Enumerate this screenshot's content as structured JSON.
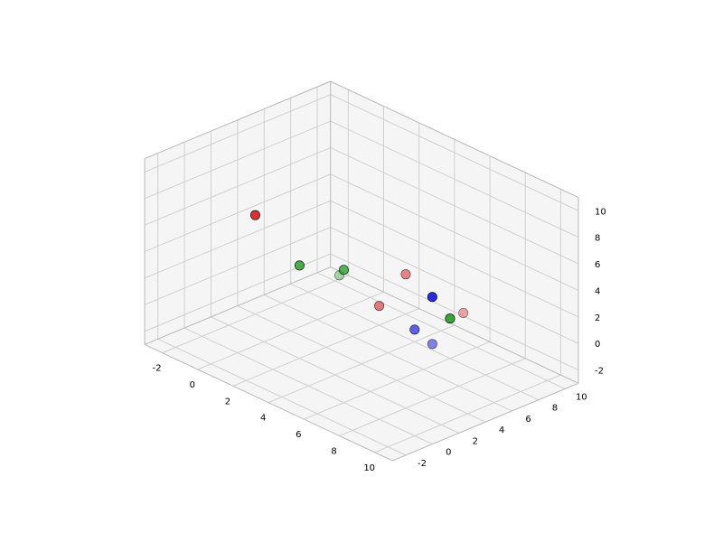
{
  "chart_data": {
    "type": "scatter3d",
    "title": "",
    "xlabel": "",
    "ylabel": "",
    "zlabel": "",
    "xlim": [
      -3,
      11
    ],
    "ylim": [
      -3,
      11
    ],
    "zlim": [
      -3,
      11
    ],
    "xticks": [
      -2,
      0,
      2,
      4,
      6,
      8,
      10
    ],
    "yticks": [
      -2,
      0,
      2,
      4,
      6,
      8,
      10
    ],
    "zticks": [
      -2,
      0,
      2,
      4,
      6,
      8,
      10
    ],
    "series": [
      {
        "name": "red",
        "color": "#d62728",
        "points": [
          {
            "x": 1,
            "y": 0,
            "z": 8,
            "alpha": 0.95
          },
          {
            "x": 2,
            "y": 10,
            "z": 0,
            "alpha": 0.55
          },
          {
            "x": 5,
            "y": 4,
            "z": 2,
            "alpha": 0.6
          },
          {
            "x": 6,
            "y": 9,
            "z": 0,
            "alpha": 0.4
          }
        ]
      },
      {
        "name": "green",
        "color": "#2ca02c",
        "points": [
          {
            "x": 2,
            "y": 2,
            "z": 4,
            "alpha": 0.85
          },
          {
            "x": 2,
            "y": 5,
            "z": 2,
            "alpha": 0.4
          },
          {
            "x": 6,
            "y": 0,
            "z": 7,
            "alpha": 0.8
          },
          {
            "x": 6,
            "y": 8,
            "z": 0,
            "alpha": 0.95
          }
        ]
      },
      {
        "name": "blue",
        "color": "#1f1fdf",
        "points": [
          {
            "x": 5,
            "y": 8,
            "z": 1,
            "alpha": 0.95
          },
          {
            "x": 8,
            "y": 4,
            "z": 1,
            "alpha": 0.55
          },
          {
            "x": 10,
            "y": 0,
            "z": 5,
            "alpha": 0.7
          }
        ]
      }
    ]
  }
}
